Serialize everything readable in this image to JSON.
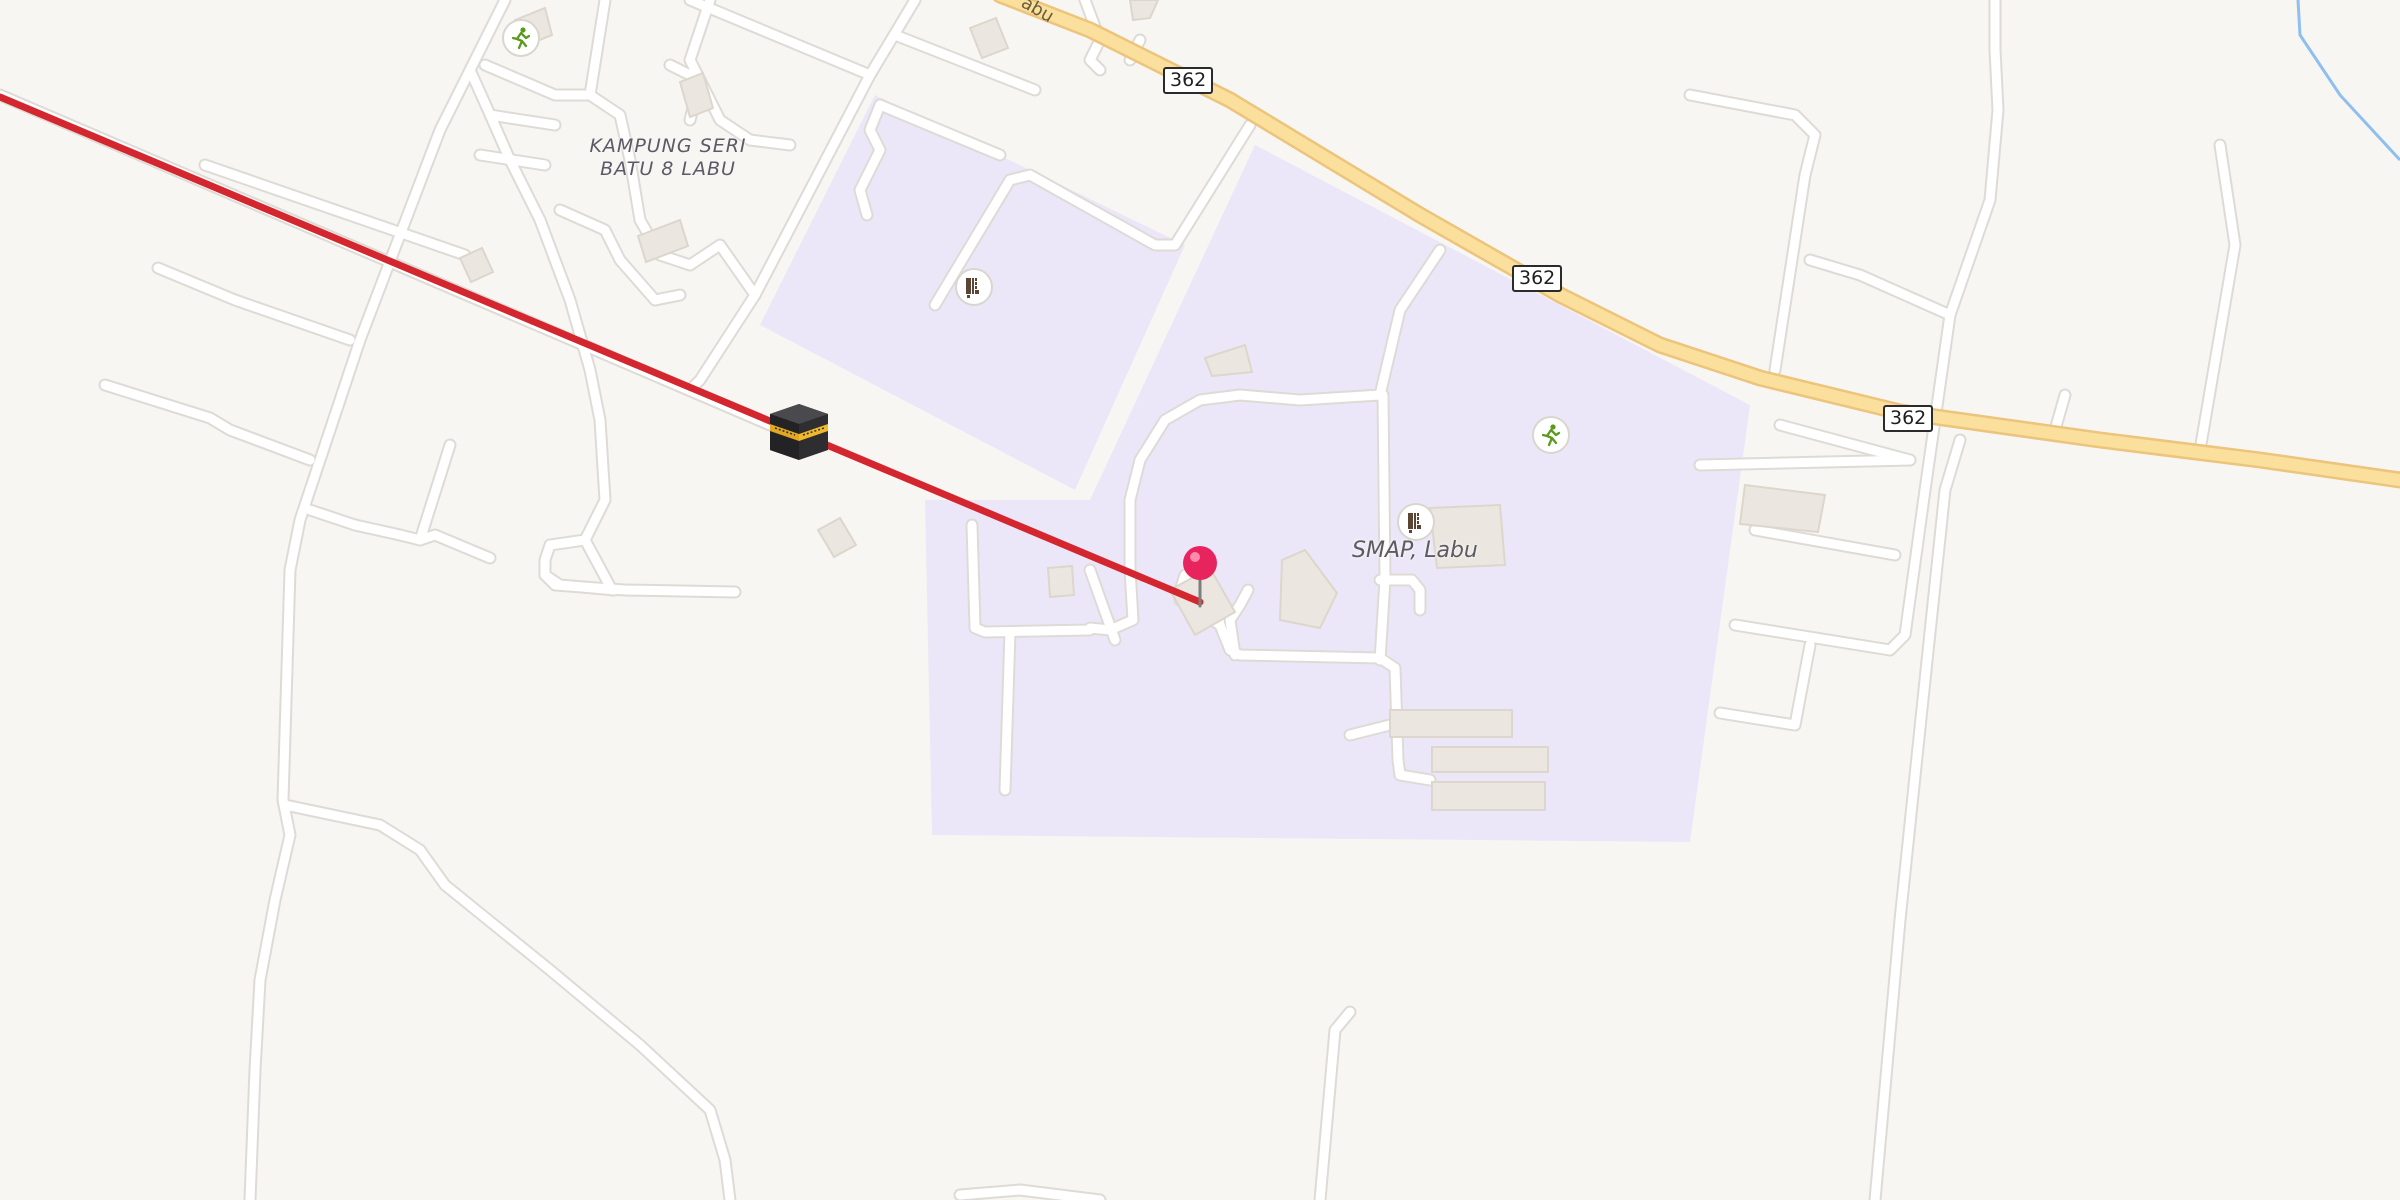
{
  "map": {
    "labels": {
      "village_line1": "KAMPUNG SERI",
      "village_line2": "BATU 8 LABU",
      "school": "SMAP, Labu",
      "road_name_partial": "abu"
    },
    "route_shields": [
      "362",
      "362",
      "362"
    ],
    "icons": {
      "kaaba": "kaaba-icon",
      "location_pin": "location-pin-icon",
      "sports": "running-person-icon",
      "school": "school-building-icon"
    },
    "colors": {
      "background": "#f8f6f2",
      "school_area": "#ece7f8",
      "road": "#ffffff",
      "road_casing": "#dedbd6",
      "main_road": "#fbdf9c",
      "main_road_casing": "#ecc47c",
      "qibla_line": "#d3262e",
      "pin": "#e8245f",
      "water": "#8fbfee",
      "building": "#ebe6df"
    }
  }
}
